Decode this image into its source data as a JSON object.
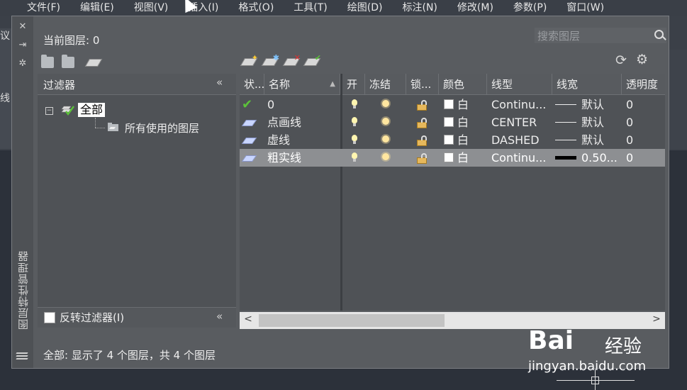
{
  "menubar": [
    "文件(F)",
    "编辑(E)",
    "视图(V)",
    "插入(I)",
    "格式(O)",
    "工具(T)",
    "绘图(D)",
    "标注(N)",
    "修改(M)",
    "参数(P)",
    "窗口(W)"
  ],
  "bg_labels": {
    "left_top": "议",
    "left_mid": "线"
  },
  "palette": {
    "vertical_title": "图层特性管理器",
    "current_layer": "当前图层: 0",
    "search_placeholder": "搜索图层",
    "filter": {
      "header": "过滤器",
      "collapse": "«",
      "tree_all": "全部",
      "tree_used": "所有使用的图层",
      "invert_label": "反转过滤器(I)",
      "invert_checked": false
    },
    "columns": [
      "状...",
      "名称",
      "开",
      "冻结",
      "锁...",
      "颜色",
      "线型",
      "线宽",
      "透明度"
    ],
    "rows": [
      {
        "status": "current",
        "name": "0",
        "color": "白",
        "linetype": "Continu...",
        "lineweight": "默认",
        "lw_thick": false,
        "transparency": "0",
        "selected": false
      },
      {
        "status": "layer",
        "name": "点画线",
        "color": "白",
        "linetype": "CENTER",
        "lineweight": "默认",
        "lw_thick": false,
        "transparency": "0",
        "selected": false
      },
      {
        "status": "layer",
        "name": "虚线",
        "color": "白",
        "linetype": "DASHED",
        "lineweight": "默认",
        "lw_thick": false,
        "transparency": "0",
        "selected": false
      },
      {
        "status": "layer",
        "name": "粗实线",
        "color": "白",
        "linetype": "Continu...",
        "lineweight": "0.50...",
        "lw_thick": true,
        "transparency": "0",
        "selected": true
      }
    ],
    "scroll": {
      "left": "<",
      "right": ">"
    },
    "footer": "全部: 显示了 4 个图层，共 4 个图层"
  },
  "watermark": {
    "brand": "Bai",
    "cn": "经验",
    "url": "jingyan.baidu.com"
  },
  "icons": {
    "close": "close-icon",
    "pin": "pin-icon",
    "settings": "gear-icon",
    "refresh": "refresh-icon",
    "search": "search-icon"
  }
}
